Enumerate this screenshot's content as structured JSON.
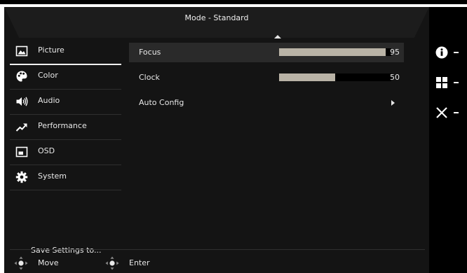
{
  "osd": {
    "title": "Mode - Standard"
  },
  "sidebar": {
    "items": [
      {
        "label": "Picture",
        "icon": "picture-icon"
      },
      {
        "label": "Color",
        "icon": "palette-icon"
      },
      {
        "label": "Audio",
        "icon": "speaker-icon"
      },
      {
        "label": "Performance",
        "icon": "trend-arrow-icon"
      },
      {
        "label": "OSD",
        "icon": "osd-window-icon"
      },
      {
        "label": "System",
        "icon": "gear-icon"
      }
    ],
    "selected": "Picture",
    "save_label": "Save Settings to..."
  },
  "picture": {
    "rows": [
      {
        "label": "Focus",
        "value": "95",
        "level": 95
      },
      {
        "label": "Clock",
        "value": "50",
        "level": 50
      },
      {
        "label": "Auto Config"
      }
    ],
    "selected": "Focus"
  },
  "footer": {
    "move_label": "Move",
    "enter_label": "Enter"
  },
  "right_keys": [
    "info-icon",
    "menu-grid-icon",
    "close-icon"
  ]
}
